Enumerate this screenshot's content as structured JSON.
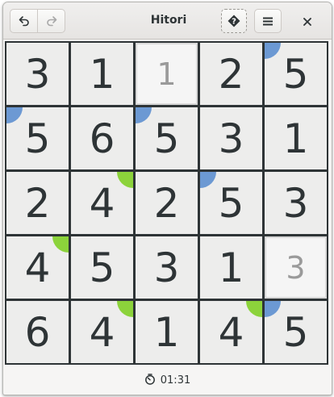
{
  "window": {
    "title": "Hitori"
  },
  "toolbar": {
    "undo_icon": "undo-icon",
    "redo_icon": "redo-icon",
    "hint_icon": "hint-icon",
    "menu_icon": "hamburger-menu-icon",
    "close_icon": "close-icon"
  },
  "board": {
    "rows": [
      [
        {
          "value": "3",
          "dim": false,
          "tag": null
        },
        {
          "value": "1",
          "dim": false,
          "tag": null
        },
        {
          "value": "1",
          "dim": true,
          "tag": null
        },
        {
          "value": "2",
          "dim": false,
          "tag": null
        },
        {
          "value": "5",
          "dim": false,
          "tag": "blue"
        }
      ],
      [
        {
          "value": "5",
          "dim": false,
          "tag": "blue"
        },
        {
          "value": "6",
          "dim": false,
          "tag": null
        },
        {
          "value": "5",
          "dim": false,
          "tag": "blue"
        },
        {
          "value": "3",
          "dim": false,
          "tag": null
        },
        {
          "value": "1",
          "dim": false,
          "tag": null
        }
      ],
      [
        {
          "value": "2",
          "dim": false,
          "tag": null
        },
        {
          "value": "4",
          "dim": false,
          "tag": "green"
        },
        {
          "value": "2",
          "dim": false,
          "tag": null
        },
        {
          "value": "5",
          "dim": false,
          "tag": "blue"
        },
        {
          "value": "3",
          "dim": false,
          "tag": null
        }
      ],
      [
        {
          "value": "4",
          "dim": false,
          "tag": "green"
        },
        {
          "value": "5",
          "dim": false,
          "tag": null
        },
        {
          "value": "3",
          "dim": false,
          "tag": null
        },
        {
          "value": "1",
          "dim": false,
          "tag": null
        },
        {
          "value": "3",
          "dim": true,
          "tag": null
        }
      ],
      [
        {
          "value": "6",
          "dim": false,
          "tag": null
        },
        {
          "value": "4",
          "dim": false,
          "tag": "green"
        },
        {
          "value": "1",
          "dim": false,
          "tag": null
        },
        {
          "value": "4",
          "dim": false,
          "tag": "green"
        },
        {
          "value": "5",
          "dim": false,
          "tag": "blue"
        }
      ]
    ]
  },
  "status": {
    "timer_icon": "stopwatch-icon",
    "time": "01:31"
  },
  "colors": {
    "tag_blue": "#6c99d3",
    "tag_green": "#8cd33b",
    "grid_line": "#2e3436",
    "cell_bg": "#ededec",
    "dim_text": "#9a9a9a"
  }
}
